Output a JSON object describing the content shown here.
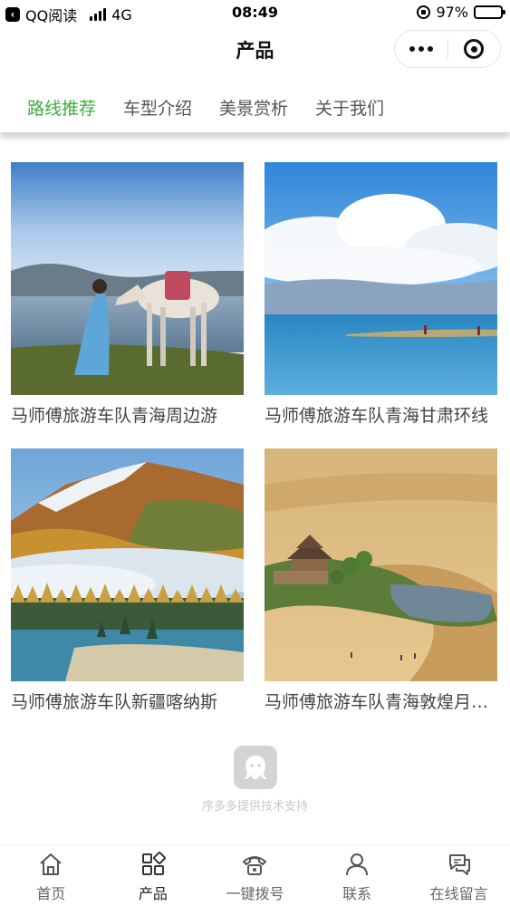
{
  "status_bar": {
    "back_app": "QQ阅读",
    "network": "4G",
    "time": "08:49",
    "battery_percent": "97%",
    "battery_level": 0.97
  },
  "nav": {
    "title": "产品"
  },
  "tabs": [
    {
      "label": "路线推荐",
      "active": true
    },
    {
      "label": "车型介绍",
      "active": false
    },
    {
      "label": "美景赏析",
      "active": false
    },
    {
      "label": "关于我们",
      "active": false
    }
  ],
  "products": [
    {
      "title": "马师傅旅游车队青海周边游",
      "image": "horse-lake-woman"
    },
    {
      "title": "马师傅旅游车队青海甘肃环线",
      "image": "blue-lake-clouds"
    },
    {
      "title": "马师傅旅游车队新疆喀纳斯",
      "image": "kanas-mountain-mist"
    },
    {
      "title": "马师傅旅游车队青海敦煌月牙泉",
      "image": "desert-crescent-spring"
    }
  ],
  "support": {
    "text": "序多多提供技术支持",
    "icon": "octopus-icon"
  },
  "tabbar": [
    {
      "label": "首页",
      "icon": "home-icon",
      "active": false
    },
    {
      "label": "产品",
      "icon": "grid-icon",
      "active": true
    },
    {
      "label": "一键拨号",
      "icon": "phone-icon",
      "active": false
    },
    {
      "label": "联系",
      "icon": "user-icon",
      "active": false
    },
    {
      "label": "在线留言",
      "icon": "chat-icon",
      "active": false
    }
  ],
  "colors": {
    "accent": "#3cae3a",
    "text": "#444444",
    "muted": "#c8c8c8"
  }
}
